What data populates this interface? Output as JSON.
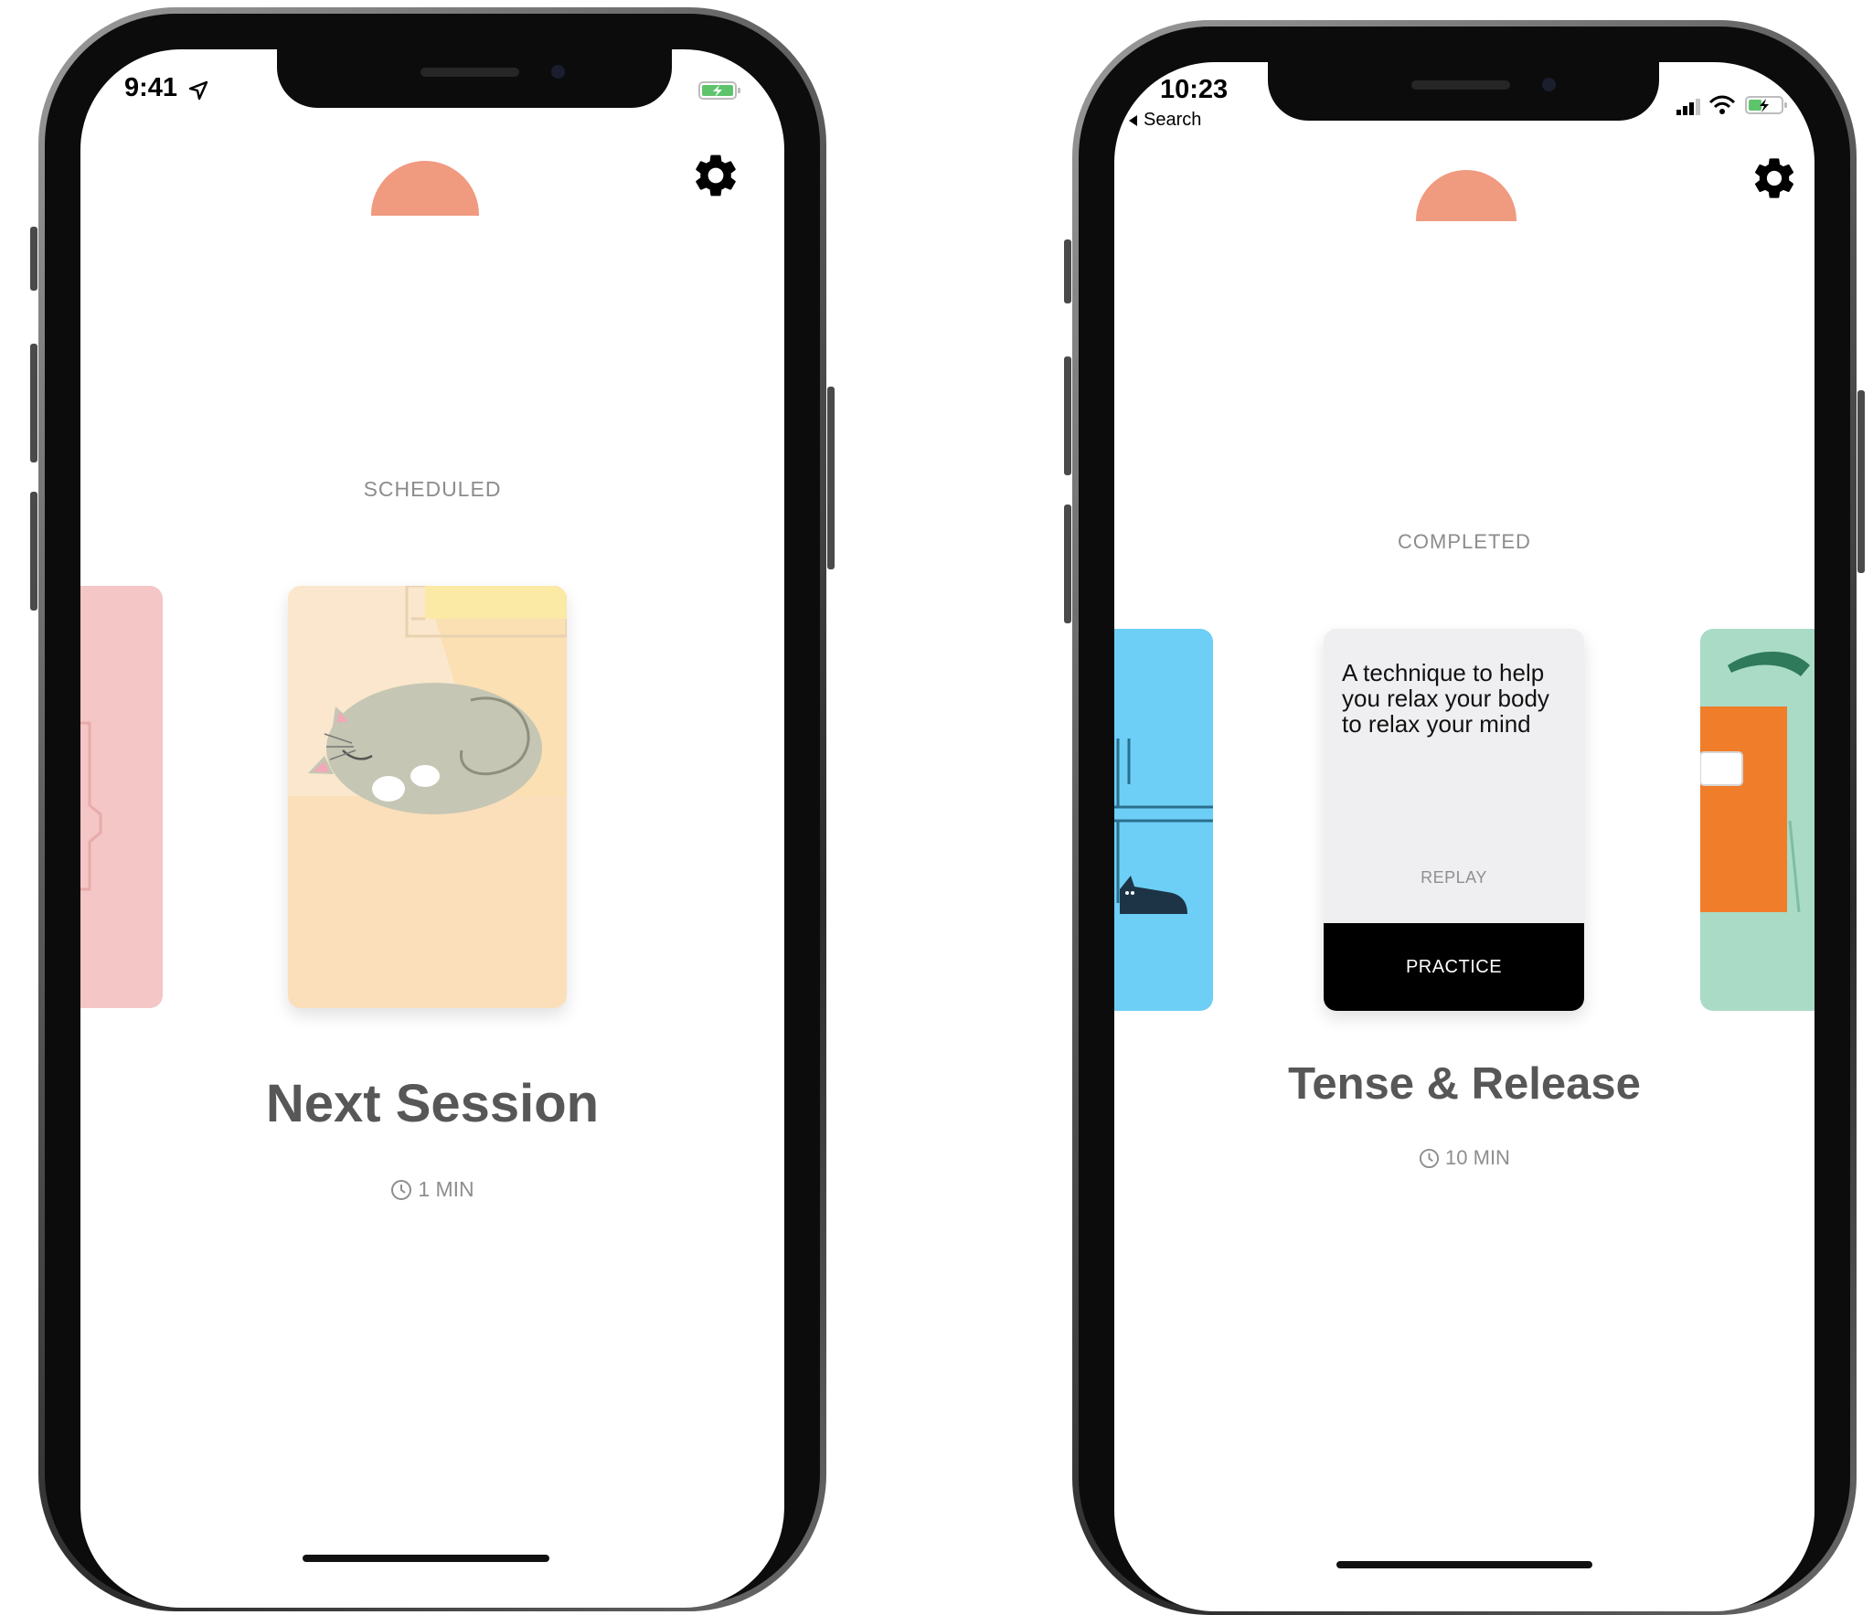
{
  "phones": [
    {
      "status_time": "9:41",
      "section_label": "SCHEDULED",
      "session_title": "Next Session",
      "duration": "1 MIN"
    },
    {
      "status_time": "10:23",
      "status_back_label": "Search",
      "section_label": "COMPLETED",
      "card_description": "A technique to help you relax your body to relax your mind",
      "replay_label": "REPLAY",
      "practice_label": "PRACTICE",
      "session_title": "Tense & Release",
      "duration": "10 MIN"
    }
  ],
  "colors": {
    "logo": "#f09a80",
    "card_pink": "#f4c6c6",
    "card_peach": "#fadfba",
    "card_blue": "#6dcff6",
    "card_green": "#a9dbc6",
    "card_orange": "#f07d2a"
  },
  "icons": [
    "location-arrow-icon",
    "battery-charging-icon",
    "gear-icon",
    "clock-icon",
    "back-caret-icon",
    "cellular-signal-icon",
    "wifi-icon"
  ]
}
